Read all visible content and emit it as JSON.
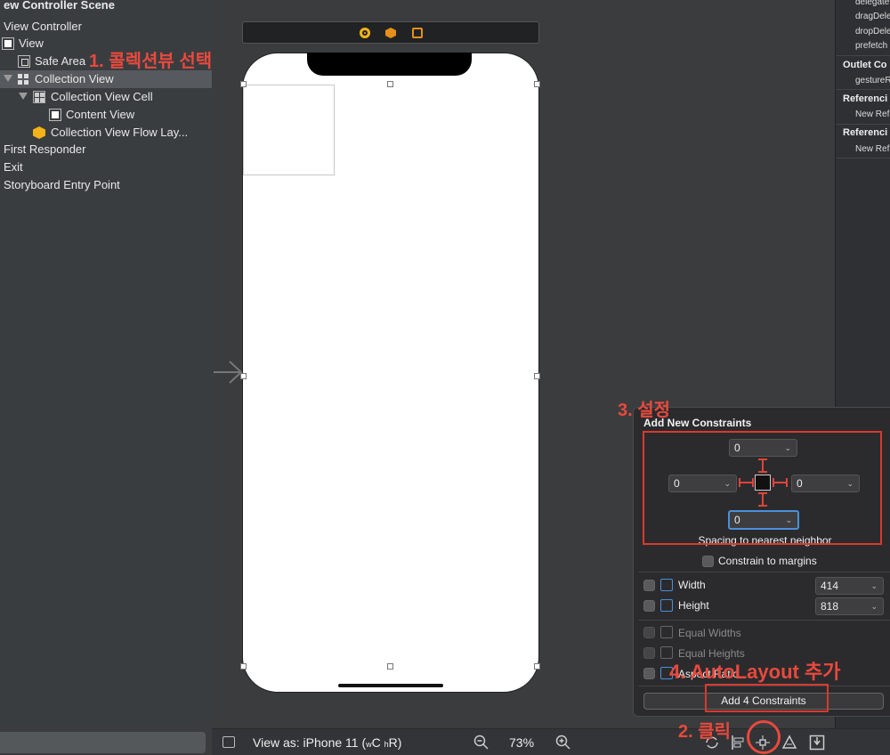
{
  "outline": {
    "scene_title": "ew Controller Scene",
    "items": [
      {
        "label": "View Controller"
      },
      {
        "label": "View"
      },
      {
        "label": "Safe Area"
      },
      {
        "label": "Collection View"
      },
      {
        "label": "Collection View Cell"
      },
      {
        "label": "Content View"
      },
      {
        "label": "Collection View Flow Lay..."
      },
      {
        "label": "First Responder"
      },
      {
        "label": "Exit"
      },
      {
        "label": "Storyboard Entry Point"
      }
    ]
  },
  "inspector": {
    "items": [
      "delegate",
      "dragDele",
      "dropDele",
      "prefetch"
    ],
    "outlet_collections_header": "Outlet Co",
    "gesture_item": "gestureR",
    "referencing1_header": "Referenci",
    "new_ref1": "New Ref",
    "referencing2_header": "Referenci",
    "new_ref2": "New Ref"
  },
  "popover": {
    "title": "Add New Constraints",
    "top_value": "0",
    "left_value": "0",
    "right_value": "0",
    "bottom_value": "0",
    "spacing_label": "Spacing to nearest neighbor",
    "constrain_margins": "Constrain to margins",
    "width_label": "Width",
    "width_value": "414",
    "height_label": "Height",
    "height_value": "818",
    "equal_widths": "Equal Widths",
    "equal_heights": "Equal Heights",
    "aspect_ratio": "Aspect Ratio",
    "add_button": "Add 4 Constraints",
    "chevron": "⌄"
  },
  "bottom_bar": {
    "view_as": "View as: iPhone 11 (",
    "wc": "w",
    "c": "C",
    "h": "h",
    "r": "R)",
    "zoom": "73%"
  },
  "annotations": {
    "step1": "1. 콜렉션뷰 선택",
    "step2": "2. 클릭",
    "step3": "3. 설정",
    "step4": "4. AutoLayout 추가"
  },
  "colors": {
    "annotation": "#e9493d",
    "selection": "#56595d",
    "focus": "#4a90d9"
  }
}
